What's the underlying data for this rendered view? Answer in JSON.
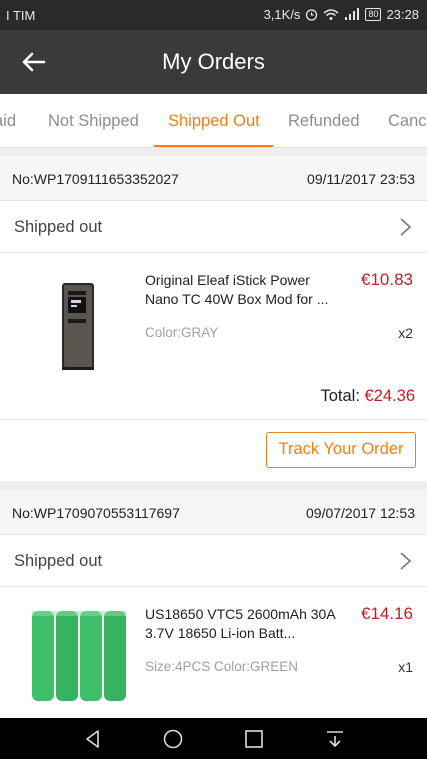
{
  "status_bar": {
    "carrier": "I TIM",
    "speed": "3,1K/s",
    "battery": "80",
    "time": "23:28"
  },
  "header": {
    "title": "My Orders",
    "back_icon": "arrow-left-icon"
  },
  "tabs": [
    {
      "label": "aid"
    },
    {
      "label": "Not Shipped"
    },
    {
      "label": "Shipped Out",
      "active": true
    },
    {
      "label": "Refunded"
    },
    {
      "label": "Canc"
    }
  ],
  "orders": [
    {
      "number": "No:WP1709111653352027",
      "date": "09/11/2017 23:53",
      "status": "Shipped out",
      "item": {
        "name": "Original Eleaf iStick Power Nano TC 40W Box Mod for ...",
        "price": "€10.83",
        "attrs": "Color:GRAY",
        "qty": "x2"
      },
      "total_label": "Total:",
      "total_value": "€24.36",
      "track_label": "Track Your Order"
    },
    {
      "number": "No:WP1709070553117697",
      "date": "09/07/2017 12:53",
      "status": "Shipped out",
      "item": {
        "name": "US18650 VTC5 2600mAh 30A 3.7V 18650 Li-ion Batt...",
        "price": "€14.16",
        "attrs": "Size:4PCS  Color:GREEN",
        "qty": "x1"
      }
    }
  ],
  "colors": {
    "accent": "#f07f13",
    "price": "#c41e23",
    "header": "#3a3a3a"
  }
}
